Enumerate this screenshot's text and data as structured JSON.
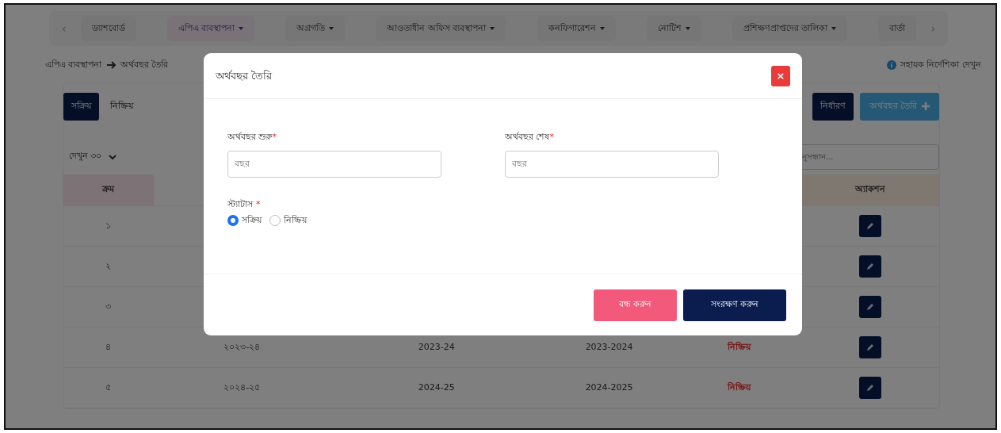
{
  "nav": {
    "prev": "‹",
    "next": "›",
    "tabs": [
      {
        "label": "ড্যাশবোর্ড",
        "dropdown": false,
        "selected": false
      },
      {
        "label": "এপিএ ব্যবস্থাপনা",
        "dropdown": true,
        "selected": true
      },
      {
        "label": "অগ্রগতি",
        "dropdown": true,
        "selected": false
      },
      {
        "label": "আওতাধীন অফিস ব্যবস্থাপনা",
        "dropdown": true,
        "selected": false
      },
      {
        "label": "কনফিগারেশন",
        "dropdown": true,
        "selected": false
      },
      {
        "label": "নোটিশ",
        "dropdown": true,
        "selected": false
      },
      {
        "label": "প্রশিক্ষণপ্রাপ্তদের তালিকা",
        "dropdown": true,
        "selected": false
      },
      {
        "label": "বার্তা",
        "dropdown": false,
        "selected": false
      }
    ]
  },
  "breadcrumb": [
    "এপিএ ব্যবস্থাপনা",
    "অর্থবছর তৈরি"
  ],
  "help_link": "সহায়ক নির্দেশিকা দেখুন",
  "filter_tabs": [
    {
      "label": "সক্রিয়",
      "selected": true
    },
    {
      "label": "নিষ্ক্রিয়",
      "selected": false
    }
  ],
  "assign_button": "নির্ধারণ",
  "create_button": "অর্থবছর তৈরি",
  "page_size": "দেখুন ৩০",
  "search": {
    "placeholder": "নুসন্ধান..."
  },
  "table": {
    "columns": [
      "ক্রম",
      "অ্যাকশন"
    ],
    "rows": [
      {
        "serial": "১"
      },
      {
        "serial": "২"
      },
      {
        "serial": "৩"
      },
      {
        "serial": "৪",
        "cells": [
          "২০২৩-২৪",
          "2023-24",
          "2023-2024"
        ],
        "status": "নিষ্ক্রিয়"
      },
      {
        "serial": "৫",
        "cells": [
          "২০২৪-২৫",
          "2024-25",
          "2024-2025"
        ],
        "status": "নিষ্ক্রিয়"
      }
    ]
  },
  "modal": {
    "title": "অর্থবছর তৈরি",
    "close": "×",
    "fields": [
      {
        "label": "অর্থবছর শুরু",
        "required_mark": "*",
        "placeholder": "বছর"
      },
      {
        "label": "অর্থবছর শেষ",
        "required_mark": "*",
        "placeholder": "বছর"
      }
    ],
    "status": {
      "label": "স্ট্যাটাস",
      "required_mark": "*",
      "options": [
        {
          "label": "সক্রিয়",
          "selected": true
        },
        {
          "label": "নিষ্ক্রিয়",
          "selected": false
        }
      ]
    },
    "buttons": [
      {
        "label": "বন্ধ করুন",
        "kind": "cancel"
      },
      {
        "label": "সংরক্ষণ করুন",
        "kind": "save"
      }
    ]
  }
}
